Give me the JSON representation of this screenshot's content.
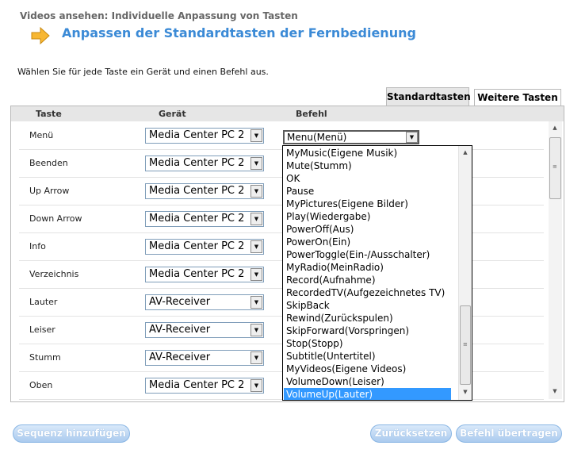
{
  "header": {
    "small_title": "Videos ansehen: Individuelle Anpassung von Tasten",
    "title": "Anpassen der Standardtasten der Fernbedienung"
  },
  "instruction": "Wählen Sie für jede Taste ein Gerät und einen Befehl aus.",
  "tabs": [
    {
      "label": "Standardtasten",
      "active": true
    },
    {
      "label": "Weitere Tasten",
      "active": false
    }
  ],
  "columns": {
    "key": "Taste",
    "device": "Gerät",
    "command": "Befehl"
  },
  "rows": [
    {
      "key": "Menü",
      "device": "Media Center PC 2"
    },
    {
      "key": "Beenden",
      "device": "Media Center PC 2"
    },
    {
      "key": "Up Arrow",
      "device": "Media Center PC 2"
    },
    {
      "key": "Down Arrow",
      "device": "Media Center PC 2"
    },
    {
      "key": "Info",
      "device": "Media Center PC 2"
    },
    {
      "key": "Verzeichnis",
      "device": "Media Center PC 2"
    },
    {
      "key": "Lauter",
      "device": "AV-Receiver"
    },
    {
      "key": "Leiser",
      "device": "AV-Receiver"
    },
    {
      "key": "Stumm",
      "device": "AV-Receiver"
    },
    {
      "key": "Oben",
      "device": "Media Center PC 2"
    }
  ],
  "command_dropdown": {
    "selected": "Menu(Menü)",
    "options": [
      "MyMusic(Eigene Musik)",
      "Mute(Stumm)",
      "OK",
      "Pause",
      "MyPictures(Eigene Bilder)",
      "Play(Wiedergabe)",
      "PowerOff(Aus)",
      "PowerOn(Ein)",
      "PowerToggle(Ein-/Ausschalter)",
      "MyRadio(MeinRadio)",
      "Record(Aufnahme)",
      "RecordedTV(Aufgezeichnetes TV)",
      "SkipBack",
      "Rewind(Zurückspulen)",
      "SkipForward(Vorspringen)",
      "Stop(Stopp)",
      "Subtitle(Untertitel)",
      "MyVideos(Eigene Videos)",
      "VolumeDown(Leiser)",
      "VolumeUp(Lauter)"
    ],
    "highlighted": "VolumeUp(Lauter)"
  },
  "buttons": {
    "add_sequence": "Sequenz hinzufügen",
    "reset": "Zurücksetzen",
    "apply": "Befehl übertragen"
  },
  "icons": {
    "header_arrow": "arrow-right-icon",
    "dropdown": "chevron-down-icon"
  },
  "colors": {
    "title": "#3b8ad6",
    "highlight": "#3399ff",
    "button_bg": "#aacaee"
  }
}
